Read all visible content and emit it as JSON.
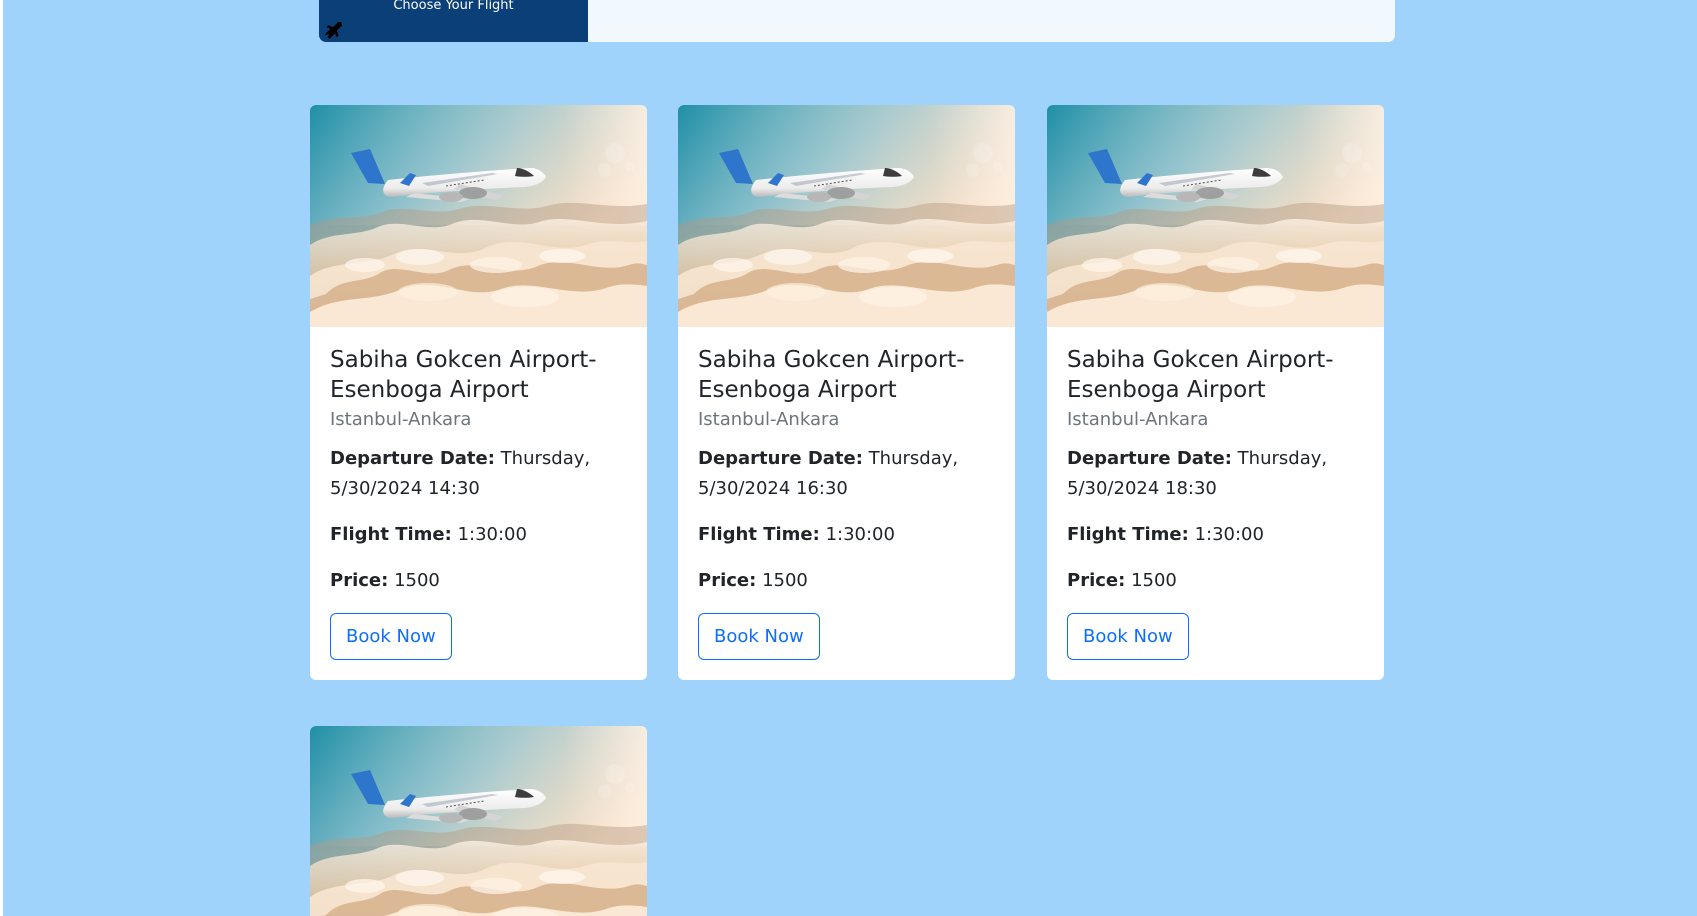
{
  "header": {
    "title": "Choose Your Flight",
    "icon": "airplane-icon"
  },
  "flights": [
    {
      "route": "Sabiha Gokcen Airport-Esenboga Airport",
      "cities": "Istanbul-Ankara",
      "departure_label": "Departure Date:",
      "departure_value": "Thursday, 5/30/2024 14:30",
      "flight_time_label": "Flight Time:",
      "flight_time_value": "1:30:00",
      "price_label": "Price:",
      "price_value": "1500",
      "button_label": "Book Now"
    },
    {
      "route": "Sabiha Gokcen Airport-Esenboga Airport",
      "cities": "Istanbul-Ankara",
      "departure_label": "Departure Date:",
      "departure_value": "Thursday, 5/30/2024 16:30",
      "flight_time_label": "Flight Time:",
      "flight_time_value": "1:30:00",
      "price_label": "Price:",
      "price_value": "1500",
      "button_label": "Book Now"
    },
    {
      "route": "Sabiha Gokcen Airport-Esenboga Airport",
      "cities": "Istanbul-Ankara",
      "departure_label": "Departure Date:",
      "departure_value": "Thursday, 5/30/2024 18:30",
      "flight_time_label": "Flight Time:",
      "flight_time_value": "1:30:00",
      "price_label": "Price:",
      "price_value": "1500",
      "button_label": "Book Now"
    }
  ],
  "colors": {
    "page_background": "#a0d3fc",
    "header_dark": "#0b3f78",
    "header_light": "#f1f9ff",
    "card_background": "#ffffff",
    "button_accent": "#0d6efd"
  }
}
